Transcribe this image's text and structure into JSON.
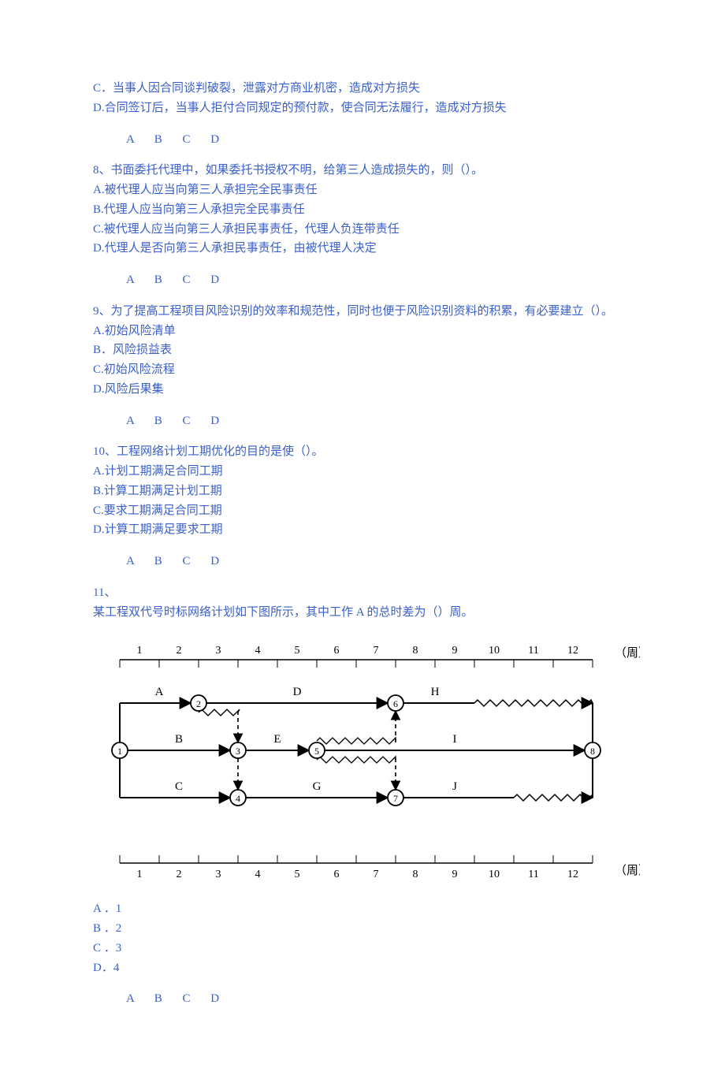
{
  "q7_tail": {
    "optC": "C．当事人因合同谈判破裂，泄露对方商业机密，造成对方损失",
    "optD": "D.合同签订后，当事人拒付合同规定的预付款，使合同无法履行，造成对方损失",
    "answers": "A B C D"
  },
  "q8": {
    "stem": "8、书面委托代理中，如果委托书授权不明，给第三人造成损失的，则（）。",
    "optA": "A.被代理人应当向第三人承担完全民事责任",
    "optB": "B.代理人应当向第三人承担完全民事责任",
    "optC": "C.被代理人应当向第三人承担民事责任，代理人负连带责任",
    "optD": "D.代理人是否向第三人承担民事责任，由被代理人决定",
    "answers": "A B C D"
  },
  "q9": {
    "stem": "9、为了提高工程项目风险识别的效率和规范性，同时也便于风险识别资料的积累，有必要建立（）。",
    "optA": "A.初始风险清单",
    "optB": "B．风险损益表",
    "optC": "C.初始风险流程",
    "optD": "D.风险后果集",
    "answers": "A B C D"
  },
  "q10": {
    "stem": "10、工程网络计划工期优化的目的是使（）。",
    "optA": "A.计划工期满足合同工期",
    "optB": "B.计算工期满足计划工期",
    "optC": "C.要求工期满足合同工期",
    "optD": "D.计算工期满足要求工期",
    "answers": "A B C D"
  },
  "q11": {
    "stem_num": "11、",
    "stem_body": "某工程双代号时标网络计划如下图所示，其中工作 A 的总时差为（）周。",
    "optA": "A ．1",
    "optB": "B ．2",
    "optC": "C ．3",
    "optD": "D．4",
    "answers": "A B C D"
  },
  "chart_data": {
    "type": "diagram",
    "description": "双代号时标网络计划 (time-scaled AON network)",
    "time_axis": {
      "unit": "周",
      "range": [
        0,
        12
      ],
      "ticks": [
        1,
        2,
        3,
        4,
        5,
        6,
        7,
        8,
        9,
        10,
        11,
        12
      ]
    },
    "nodes": [
      {
        "id": 1,
        "time": 0,
        "row": "mid"
      },
      {
        "id": 2,
        "time": 2,
        "row": "top"
      },
      {
        "id": 3,
        "time": 3,
        "row": "mid"
      },
      {
        "id": 4,
        "time": 3,
        "row": "bot"
      },
      {
        "id": 5,
        "time": 5,
        "row": "mid"
      },
      {
        "id": 6,
        "time": 7,
        "row": "top"
      },
      {
        "id": 7,
        "time": 7,
        "row": "bot"
      },
      {
        "id": 8,
        "time": 12,
        "row": "mid"
      }
    ],
    "activities": [
      {
        "name": "A",
        "from": 1,
        "to": 2,
        "row": "top",
        "start": 0,
        "end": 2,
        "float": 0
      },
      {
        "name": "D",
        "from": 2,
        "to": 6,
        "row": "top",
        "start": 2,
        "end": 7,
        "float": 0
      },
      {
        "name": "H",
        "from": 6,
        "to": 8,
        "row": "top",
        "start": 7,
        "end": 9,
        "float": 3
      },
      {
        "name": "B",
        "from": 1,
        "to": 3,
        "row": "mid",
        "start": 0,
        "end": 3,
        "float": 0
      },
      {
        "name": "E",
        "from": 3,
        "to": 5,
        "row": "mid",
        "start": 3,
        "end": 5,
        "float": 0
      },
      {
        "name": "I",
        "from": 5,
        "to": 8,
        "row": "mid",
        "start": 5,
        "end": 12,
        "float": 0
      },
      {
        "name": "C",
        "from": 1,
        "to": 4,
        "row": "bot",
        "start": 0,
        "end": 3,
        "float": 0
      },
      {
        "name": "G",
        "from": 4,
        "to": 7,
        "row": "bot",
        "start": 3,
        "end": 7,
        "float": 0
      },
      {
        "name": "J",
        "from": 7,
        "to": 8,
        "row": "bot",
        "start": 7,
        "end": 10,
        "float": 2
      }
    ],
    "dummies": [
      {
        "from": 2,
        "to": 3,
        "float_start": 2,
        "float_end": 3
      },
      {
        "from": 3,
        "to": 4
      },
      {
        "from": 5,
        "to": 6,
        "float_start": 5,
        "float_end": 7
      },
      {
        "from": 5,
        "to": 7,
        "float_start": 5,
        "float_end": 7
      }
    ]
  }
}
